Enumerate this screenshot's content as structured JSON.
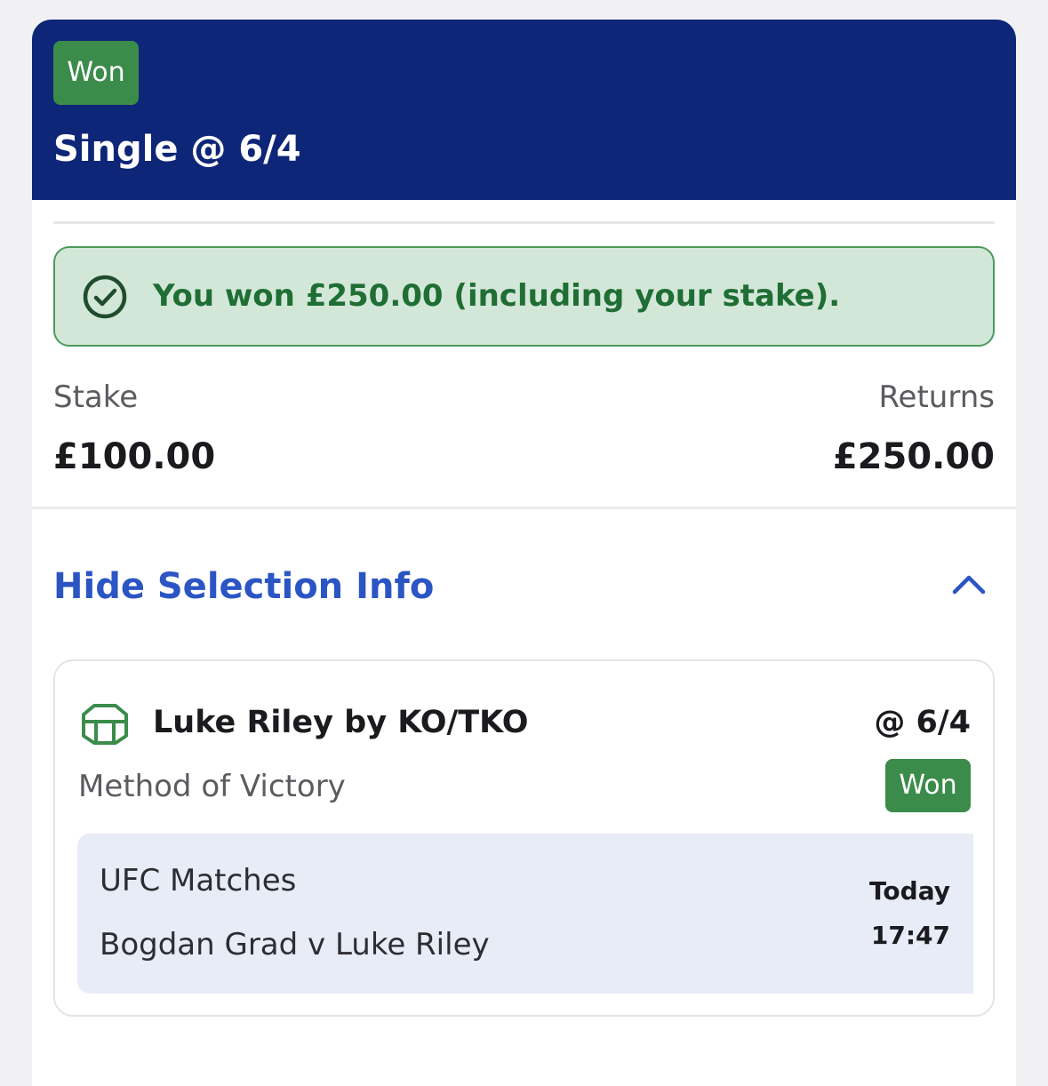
{
  "bet": {
    "status": "Won",
    "title": "Single @ 6/4"
  },
  "result_banner": {
    "icon": "check-circle-icon",
    "text": "You won £250.00 (including your stake)."
  },
  "summary": {
    "stake_label": "Stake",
    "stake_value": "£100.00",
    "returns_label": "Returns",
    "returns_value": "£250.00"
  },
  "toggle": {
    "label": "Hide Selection Info",
    "icon": "chevron-up-icon"
  },
  "selection": {
    "icon": "octagon-ring-icon",
    "name": "Luke Riley by KO/TKO",
    "odds": "@ 6/4",
    "market": "Method of Victory",
    "status": "Won",
    "competition": "UFC Matches",
    "event": "Bogdan Grad v Luke Riley",
    "day": "Today",
    "time": "17:47"
  },
  "colors": {
    "header_bg": "#0e2677",
    "won_green": "#3b8c4a",
    "banner_bg": "#d3e7d9",
    "banner_text": "#1f6e34",
    "link_blue": "#2c55c4",
    "event_panel_bg": "#e7ecf7"
  }
}
